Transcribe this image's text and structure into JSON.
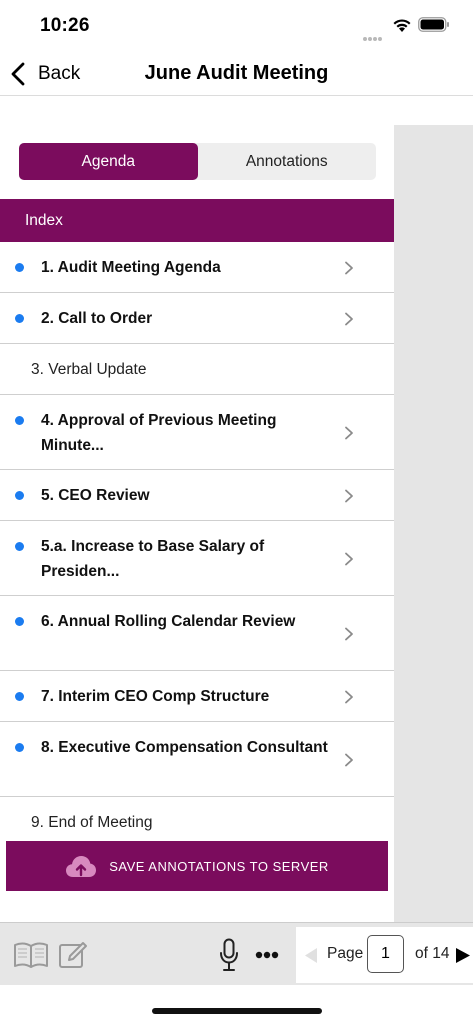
{
  "status_bar": {
    "time": "10:26"
  },
  "nav": {
    "back_label": "Back",
    "title": "June Audit Meeting"
  },
  "tabs": [
    {
      "label": "Agenda",
      "active": true
    },
    {
      "label": "Annotations",
      "active": false
    }
  ],
  "index_header": "Index",
  "agenda_items": [
    {
      "label": "1. Audit Meeting Agenda",
      "has_document": true,
      "has_chevron": true
    },
    {
      "label": "2. Call to Order",
      "has_document": true,
      "has_chevron": true
    },
    {
      "label": "3. Verbal Update",
      "has_document": false,
      "has_chevron": false
    },
    {
      "label": "4. Approval of Previous Meeting Minute...",
      "has_document": true,
      "has_chevron": true
    },
    {
      "label": "5. CEO Review",
      "has_document": true,
      "has_chevron": true
    },
    {
      "label": "5.a. Increase to Base Salary of Presiden...",
      "has_document": true,
      "has_chevron": true
    },
    {
      "label": "6. Annual Rolling Calendar Review",
      "has_document": true,
      "has_chevron": true
    },
    {
      "label": "7. Interim CEO Comp Structure",
      "has_document": true,
      "has_chevron": true
    },
    {
      "label": "8. Executive Compensation Consultant",
      "has_document": true,
      "has_chevron": true
    },
    {
      "label": "9. End of Meeting",
      "has_document": false,
      "has_chevron": false
    }
  ],
  "save_button": {
    "label": "SAVE ANNOTATIONS TO SERVER",
    "icon": "cloud-upload-icon"
  },
  "toolbar": {
    "icons": [
      "book-icon",
      "pencil-icon",
      "microphone-icon",
      "more-icon"
    ],
    "page_label": "Page",
    "page_value": "1",
    "of_label": "of 14"
  },
  "colors": {
    "accent": "#7b0c5d",
    "unread_dot": "#1b7cf0",
    "side_panel": "#e5e5e5",
    "toolbar_bg": "#e6e6e6"
  }
}
